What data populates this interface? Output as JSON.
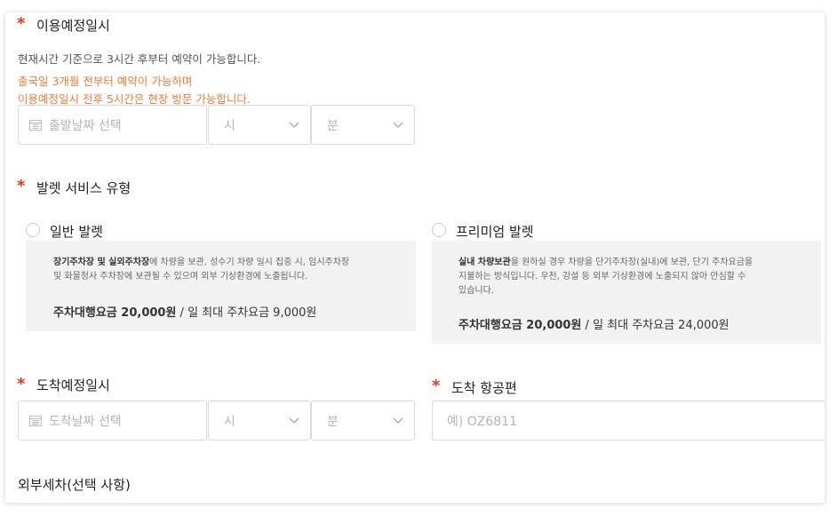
{
  "usage_date": {
    "required_mark": "*",
    "label": "이용예정일시",
    "note": "현재시간 기준으로 3시간 후부터 예약이 가능합니다.",
    "warning_1": "출국일 3개월 전부터 예약이 가능하며",
    "warning_2": "이용예정일시 전후 5시간은 현장 방문 가능합니다.",
    "date_placeholder": "출발날짜 선택",
    "hour_placeholder": "시",
    "minute_placeholder": "분"
  },
  "valet": {
    "required_mark": "*",
    "label": "발렛 서비스 유형",
    "options": [
      {
        "label": "일반 발렛",
        "desc_bold": "장기주차장 및 실외주차장",
        "desc_line1_rest": "에 차량을 보관, 성수기 차량 일시 집중 시, 임시주차장",
        "desc_line2": "및 화물청사 주차장에 보관될 수 있으며 외부 기상환경에 노출됩니다.",
        "price_bold": "주차대행요금 20,000원",
        "price_rest": " / 일 최대 주차요금 9,000원"
      },
      {
        "label": "프리미엄 발렛",
        "desc_bold": "실내 차량보관",
        "desc_line1_rest": "을 원하실 경우 차량을 단기주차장(실내)에 보관, 단기 주차요금을",
        "desc_line2": "지불하는 방식입니다. 우천, 강설 등 외부 기상환경에 노출되지 않아 안심할 수",
        "desc_line3": "있습니다.",
        "price_bold": "주차대행요금 20,000원",
        "price_rest": " / 일 최대 주차요금 24,000원"
      }
    ]
  },
  "arrival_date": {
    "required_mark": "*",
    "label": "도착예정일시",
    "date_placeholder": "도착날짜 선택",
    "hour_placeholder": "시",
    "minute_placeholder": "분"
  },
  "arrival_flight": {
    "required_mark": "*",
    "label": "도착 항공편",
    "placeholder": "예) OZ6811"
  },
  "exterior_wash": {
    "label": "외부세차(선택 사항)"
  }
}
